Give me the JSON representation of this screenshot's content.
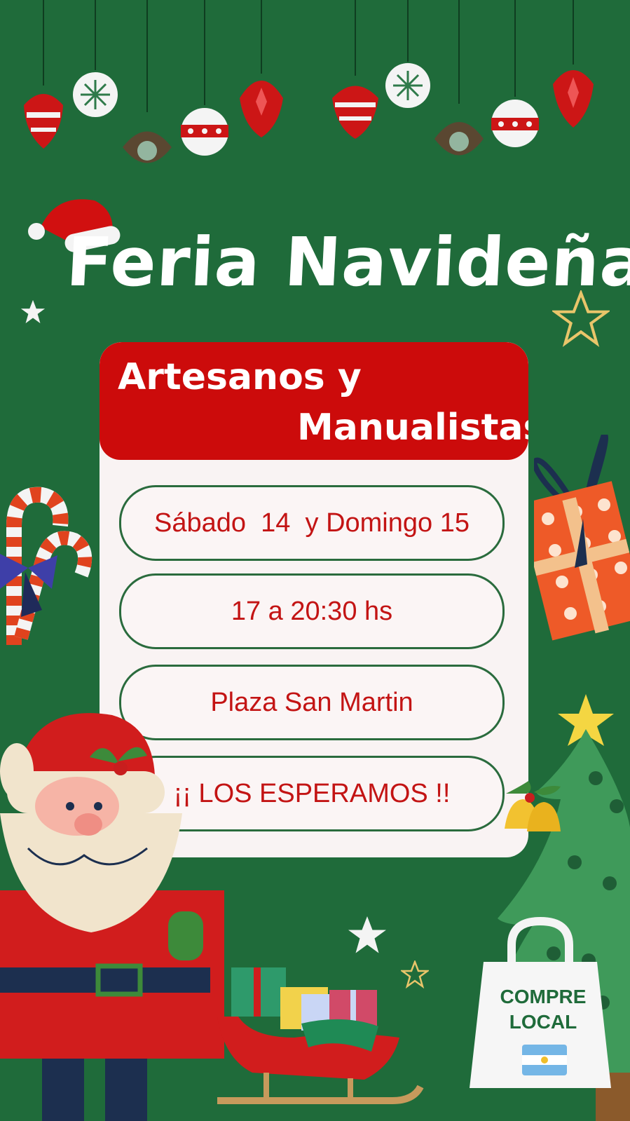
{
  "poster": {
    "title": "Feria Navideña",
    "header_line1": "Artesanos   y",
    "header_line2": "Manualistas",
    "details": [
      {
        "text": "Sábado  14  y Domingo 15"
      },
      {
        "text": "17 a 20:30 hs"
      },
      {
        "text": "Plaza San Martin"
      },
      {
        "text": "¡¡ LOS ESPERAMOS !!"
      }
    ],
    "bag_line1": "COMPRE",
    "bag_line2": "LOCAL"
  },
  "colors": {
    "background": "#1f6b3a",
    "red": "#cc0b0b",
    "card": "#f9f3f3",
    "text_red": "#c31414"
  },
  "icons": [
    "ornament-icon",
    "santa-hat-icon",
    "star-icon",
    "gift-icon",
    "candy-cane-icon",
    "santa-claus-icon",
    "sleigh-icon",
    "christmas-tree-icon",
    "bells-icon",
    "shopping-bag-icon",
    "argentina-flag-icon"
  ]
}
